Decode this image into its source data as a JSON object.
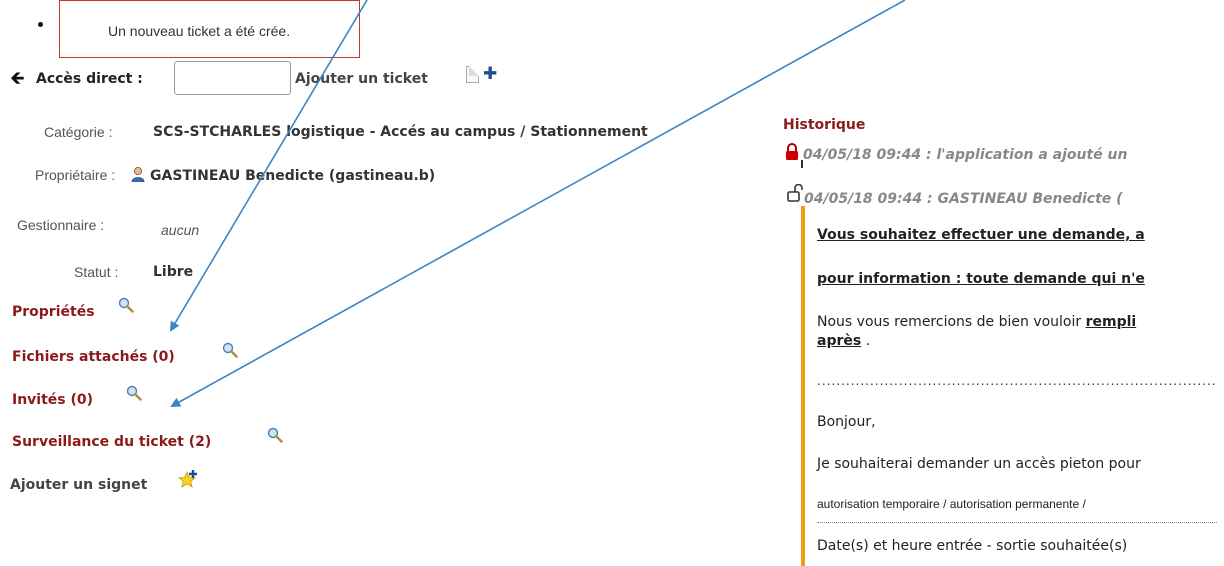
{
  "notification": {
    "text": "Un nouveau ticket a été crée."
  },
  "direct_access": {
    "label": "Accès direct :",
    "input_value": "",
    "input_placeholder": ""
  },
  "add_ticket": {
    "label": "Ajouter un ticket"
  },
  "fields": {
    "categorie": {
      "label": "Catégorie :",
      "value": "SCS-STCHARLES logistique - Accés au campus / Stationnement"
    },
    "proprietaire": {
      "label": "Propriétaire :",
      "value": "GASTINEAU Benedicte (gastineau.b)"
    },
    "gestionnaire": {
      "label": "Gestionnaire :",
      "value": "aucun"
    },
    "statut": {
      "label": "Statut :",
      "value": "Libre"
    }
  },
  "sections": {
    "proprietes": "Propriétés",
    "fichiers": "Fichiers attachés (0)",
    "invites": "Invités (0)",
    "surveillance": "Surveillance du ticket (2)",
    "signet": "Ajouter un signet"
  },
  "historique": {
    "title": "Historique",
    "entry1": "04/05/18 09:44 : l'application a ajouté un",
    "entry2": "04/05/18 09:44 : GASTINEAU Benedicte (",
    "line1": "Vous souhaitez effectuer une demande, a",
    "line2": "pour information : toute demande qui n'e",
    "line3_pre": "Nous vous remercions de bien vouloir ",
    "line3_link": "rempli",
    "line3b": "après",
    "line3b_post": " .",
    "dots": "............................................................................................................",
    "bonjour": "Bonjour,",
    "line4": "Je souhaiterai demander un accès pieton pour",
    "line5": "autorisation temporaire / autorisation permanente /",
    "line6": "Date(s) et heure entrée - sortie souhaitée(s)"
  },
  "colors": {
    "accent": "#8b1a1a",
    "annotation_arrow": "#3a86c8",
    "notice_border": "#c0392b",
    "history_bar": "#f39c12"
  }
}
